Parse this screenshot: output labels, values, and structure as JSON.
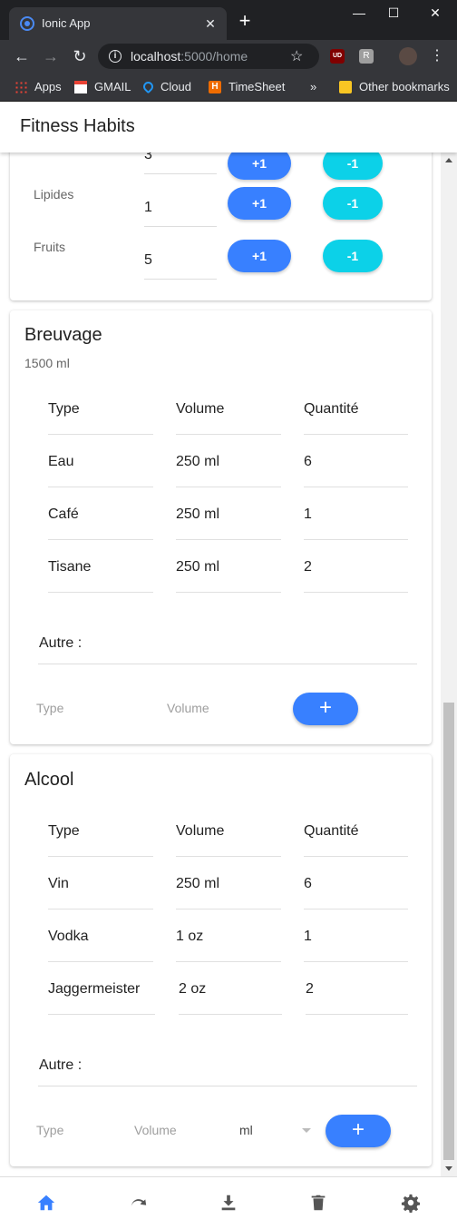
{
  "browser": {
    "tab_title": "Ionic App",
    "tab_close": "✕",
    "new_tab": "+",
    "url_host": "localhost",
    "url_rest": ":5000/home",
    "ext_ublock": "UD",
    "ext_r": "R",
    "bookmarks": [
      {
        "label": "Apps",
        "icon": "apps-grid-icon"
      },
      {
        "label": "GMAIL",
        "icon": "gmail-icon"
      },
      {
        "label": "Cloud",
        "icon": "cloud-icon"
      },
      {
        "label": "TimeSheet",
        "icon": "timesheet-icon"
      }
    ],
    "bookmarks_overflow": "»",
    "other_bookmarks": "Other bookmarks",
    "timesheet_letter": "H"
  },
  "app": {
    "title": "Fitness Habits"
  },
  "nutrition": {
    "rows": [
      {
        "label": "",
        "value": "3",
        "plus": "+1",
        "minus": "-1"
      },
      {
        "label": "Lipides",
        "value": "1",
        "plus": "+1",
        "minus": "-1"
      },
      {
        "label": "Fruits",
        "value": "5",
        "plus": "+1",
        "minus": "-1"
      }
    ]
  },
  "breuvage": {
    "title": "Breuvage",
    "subtitle": "1500 ml",
    "headers": [
      "Type",
      "Volume",
      "Quantité"
    ],
    "rows": [
      [
        "Eau",
        "250 ml",
        "6"
      ],
      [
        "Café",
        "250 ml",
        "1"
      ],
      [
        "Tisane",
        "250 ml",
        "2"
      ]
    ],
    "autre_label": "Autre :",
    "type_placeholder": "Type",
    "volume_placeholder": "Volume",
    "add_label": "+"
  },
  "alcool": {
    "title": "Alcool",
    "headers": [
      "Type",
      "Volume",
      "Quantité"
    ],
    "rows": [
      [
        "Vin",
        "250 ml",
        "6"
      ],
      [
        "Vodka",
        "1 oz",
        "1"
      ],
      [
        "Jaggermeister",
        "2 oz",
        "2"
      ]
    ],
    "autre_label": "Autre :",
    "type_placeholder": "Type",
    "volume_placeholder": "Volume",
    "unit_value": "ml",
    "add_label": "+"
  },
  "tabbar": {
    "items": [
      "home-icon",
      "redo-icon",
      "download-icon",
      "trash-icon",
      "settings-icon"
    ],
    "active_color": "#3880ff",
    "inactive_color": "#555555"
  }
}
